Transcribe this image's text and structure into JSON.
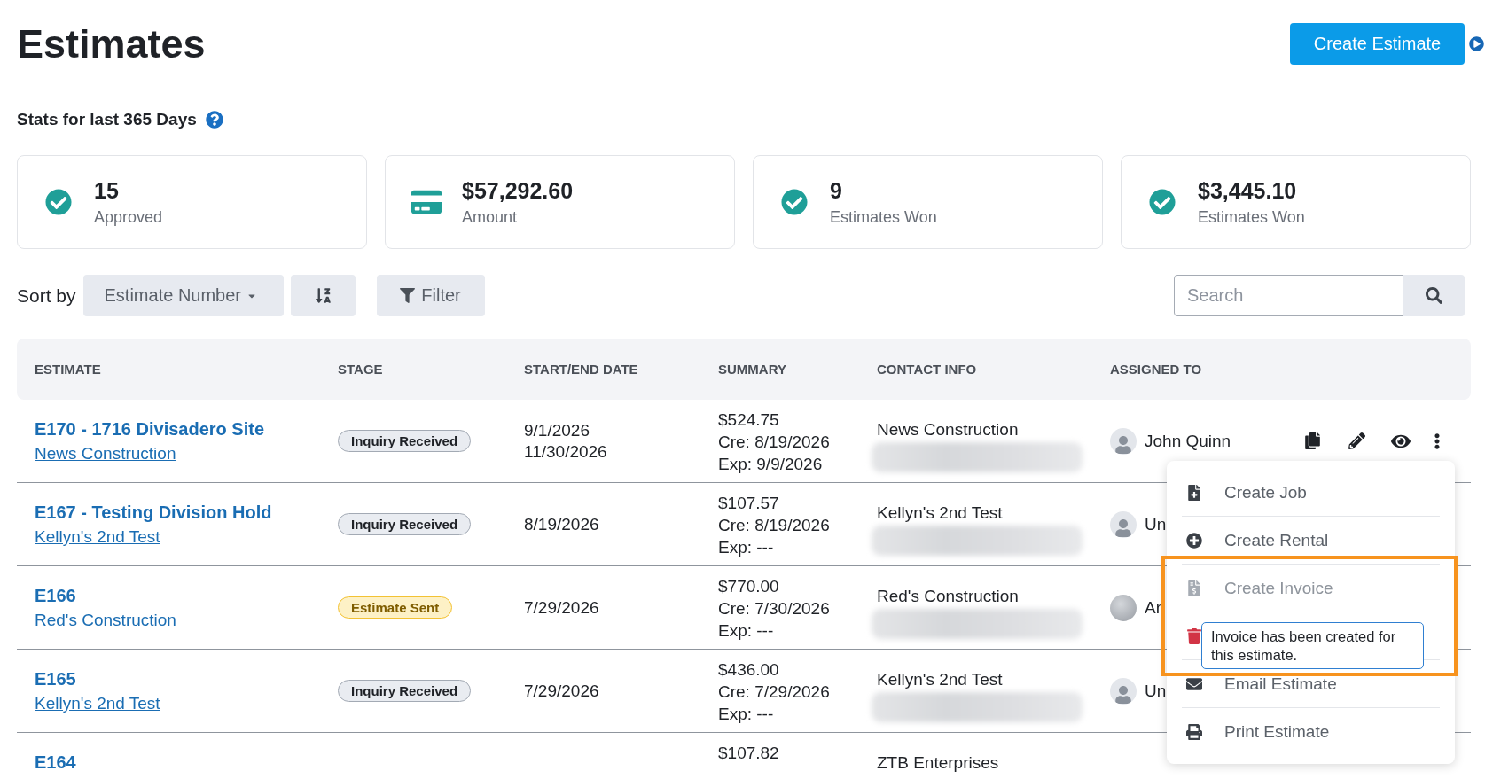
{
  "page": {
    "title": "Estimates",
    "create_button": "Create Estimate"
  },
  "stats": {
    "title": "Stats for last 365 Days",
    "cards": [
      {
        "value": "15",
        "label": "Approved"
      },
      {
        "value": "$57,292.60",
        "label": "Amount"
      },
      {
        "value": "9",
        "label": "Estimates Won"
      },
      {
        "value": "$3,445.10",
        "label": "Estimates Won"
      }
    ]
  },
  "toolbar": {
    "sort_label": "Sort by",
    "sort_field": "Estimate Number",
    "filter_button": "Filter",
    "search": {
      "placeholder": "Search"
    }
  },
  "table": {
    "columns": [
      "ESTIMATE",
      "STAGE",
      "START/END DATE",
      "SUMMARY",
      "CONTACT INFO",
      "ASSIGNED TO"
    ],
    "rows": [
      {
        "title": "E170 - 1716 Divisadero Site",
        "customer": "News Construction",
        "stage": {
          "label": "Inquiry Received",
          "kind": "neutral"
        },
        "dates": [
          "9/1/2026",
          "11/30/2026"
        ],
        "summary": [
          "$524.75",
          "Cre: 8/19/2026",
          "Exp: 9/9/2026"
        ],
        "contact": {
          "name": "News Construction",
          "details_blurred": true
        },
        "assigned": {
          "name": "John Quinn",
          "kind": "person"
        },
        "actions_visible": true
      },
      {
        "title": "E167 - Testing Division Hold",
        "customer": "Kellyn's 2nd Test",
        "stage": {
          "label": "Inquiry Received",
          "kind": "neutral"
        },
        "dates": [
          "8/19/2026"
        ],
        "summary": [
          "$107.57",
          "Cre: 8/19/2026",
          "Exp: ---"
        ],
        "contact": {
          "name": "Kellyn's 2nd Test",
          "details_blurred": true
        },
        "assigned": {
          "name": "Un",
          "kind": "person"
        },
        "actions_visible": false
      },
      {
        "title": "E166",
        "customer": "Red's Construction",
        "stage": {
          "label": "Estimate Sent",
          "kind": "warning"
        },
        "dates": [
          "7/29/2026"
        ],
        "summary": [
          "$770.00",
          "Cre: 7/30/2026",
          "Exp: ---"
        ],
        "contact": {
          "name": "Red's Construction",
          "details_blurred": true
        },
        "assigned": {
          "name": "Ar",
          "kind": "photo"
        },
        "actions_visible": false
      },
      {
        "title": "E165",
        "customer": "Kellyn's 2nd Test",
        "stage": {
          "label": "Inquiry Received",
          "kind": "neutral"
        },
        "dates": [
          "7/29/2026"
        ],
        "summary": [
          "$436.00",
          "Cre: 7/29/2026",
          "Exp: ---"
        ],
        "contact": {
          "name": "Kellyn's 2nd Test",
          "details_blurred": true
        },
        "assigned": {
          "name": "Un",
          "kind": "person"
        },
        "actions_visible": false
      },
      {
        "title": "E164",
        "summary": [
          "$107.82"
        ],
        "contact": {
          "name": "ZTB Enterprises",
          "details_blurred": false
        },
        "actions_visible": false
      }
    ]
  },
  "row_menu": {
    "items": [
      {
        "label": "Create Job",
        "kind": "action",
        "disabled": false,
        "highlighted": false
      },
      {
        "label": "Create Rental",
        "kind": "action",
        "disabled": false,
        "highlighted": false
      },
      {
        "label": "Create Invoice",
        "kind": "action",
        "disabled": true,
        "highlighted": true,
        "tooltip": "Invoice has been created for this estimate."
      },
      {
        "kind": "danger",
        "disabled": false,
        "highlighted": false
      },
      {
        "label": "Email Estimate",
        "kind": "action",
        "disabled": false,
        "highlighted": false
      },
      {
        "label": "Print Estimate",
        "kind": "action",
        "disabled": false,
        "highlighted": false
      }
    ]
  }
}
